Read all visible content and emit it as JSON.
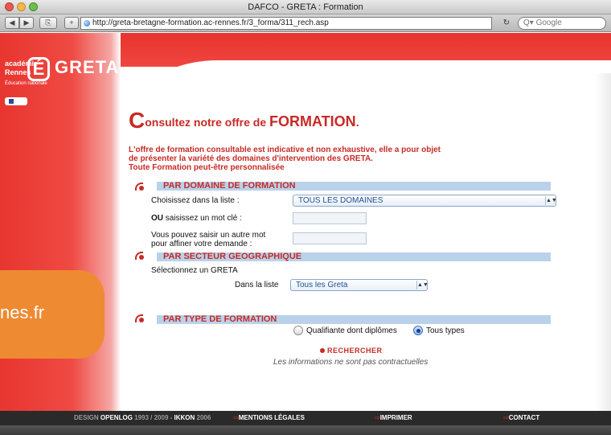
{
  "window": {
    "title": "DAFCO - GRETA : Formation"
  },
  "toolbar": {
    "url": "http://greta-bretagne-formation.ac-rennes.fr/3_forma/311_rech.asp",
    "search_placeholder": "Q▾ Google",
    "reload": "↻"
  },
  "logo": {
    "academie": "académie",
    "rennes": "Rennes",
    "e_letter": "É",
    "greta": "GRETA",
    "education": "Éducation nationale"
  },
  "heading": {
    "first_letter": "C",
    "rest": "onsultez notre offre de ",
    "caps": "FORMATION",
    "dot": "."
  },
  "intro": {
    "line1": "L'offre de formation consultable est indicative et non exhaustive, elle a pour objet",
    "line2": "de présenter la variété des domaines d'intervention des GRETA.",
    "line3": "Toute Formation peut-être personnalisée"
  },
  "domaine": {
    "title": "PAR DOMAINE DE FORMATION",
    "choose_label": "Choisissez dans la liste :",
    "select_value": "TOUS LES DOMAINES",
    "ou": "OU",
    "keyword_label": "saisissez un mot clé :",
    "other_keyword_label_1": "Vous pouvez saisir un autre mot",
    "other_keyword_label_2": "pour affiner votre demande :"
  },
  "secteur": {
    "title": "PAR SECTEUR GEOGRAPHIQUE",
    "select_greta": "Sélectionnez un GRETA",
    "list_label": "Dans la liste",
    "select_value": "Tous les Greta"
  },
  "type": {
    "title": "PAR TYPE DE FORMATION",
    "option1": "Qualifiante dont diplômes",
    "option2": "Tous types",
    "selected": "Tous types"
  },
  "actions": {
    "search": "RECHERCHER",
    "disclaimer": "Les informations ne sont pas contractuelles"
  },
  "footer": {
    "credit_prefix": "DESIGN ",
    "credit_name1": "OPENLOG",
    "credit_mid": " 1993 / 2009 - ",
    "credit_name2": "IKKON",
    "credit_year": " 2006",
    "mentions": "MENTIONS LÉGALES",
    "print": "IMPRIMER",
    "contact": "CONTACT"
  },
  "overlay": {
    "text": "nes.fr"
  },
  "colors": {
    "brand_red": "#c72a25",
    "section_blue": "#b9d2ea",
    "overlay_orange": "#ee8a32"
  }
}
